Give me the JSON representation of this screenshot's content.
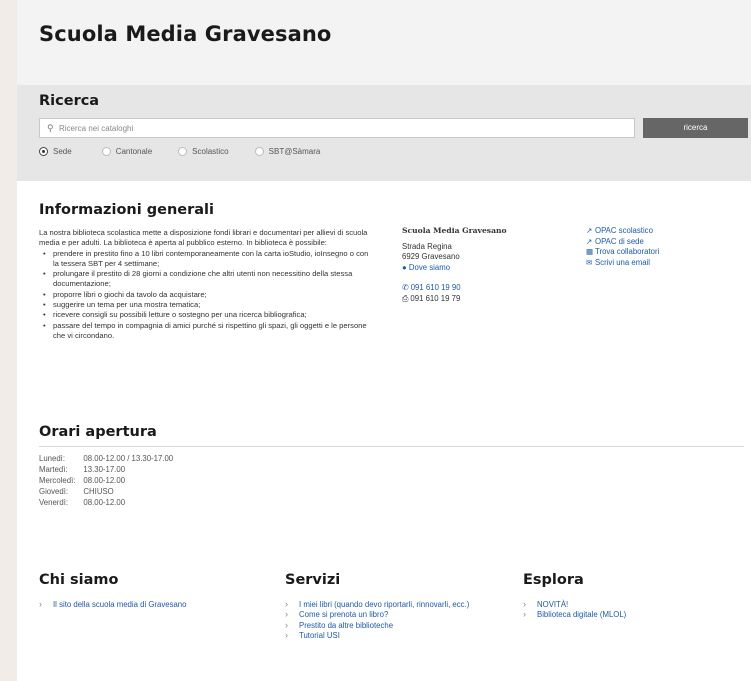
{
  "header": {
    "title": "Scuola Media Gravesano"
  },
  "search": {
    "title": "Ricerca",
    "placeholder": "Ricerca nei cataloghi",
    "button_label": "ricerca",
    "scopes": [
      {
        "label": "Sede",
        "selected": true
      },
      {
        "label": "Cantonale",
        "selected": false
      },
      {
        "label": "Scolastico",
        "selected": false
      },
      {
        "label": "SBT@Sàmara",
        "selected": false
      }
    ]
  },
  "info": {
    "title": "Informazioni generali",
    "description": "La nostra biblioteca scolastica mette a disposizione fondi librari e documentari per allievi di scuola media e per adulti. La biblioteca è aperta al pubblico esterno. In biblioteca è possibile:",
    "bullets": [
      "prendere in prestito fino a 10 libri contemporaneamente con la carta ioStudio, ioInsegno o con la tessera SBT per 4 settimane;",
      "prolungare il prestito di 28 giorni a condizione che altri utenti non necessitino della stessa documentazione;",
      "proporre libri o giochi da tavolo da acquistare;",
      "suggerire un tema per una mostra tematica;",
      "ricevere consigli su possibili letture o sostegno per una ricerca bibliografica;",
      "passare del tempo in compagnia di amici purché si rispettino gli spazi, gli oggetti e le persone che vi circondano."
    ],
    "contact": {
      "name": "Scuola Media Gravesano",
      "street": "Strada Regina",
      "city": "6929 Gravesano",
      "map_link": "Dove siamo",
      "phone": "091 610 19 90",
      "fax": "091 610 19 79"
    },
    "links": [
      {
        "icon": "external-link-icon",
        "label": "OPAC scolastico"
      },
      {
        "icon": "external-link-icon",
        "label": "OPAC di sede"
      },
      {
        "icon": "id-card-icon",
        "label": "Trova collaboratori"
      },
      {
        "icon": "envelope-icon",
        "label": "Scrivi una email"
      }
    ]
  },
  "hours": {
    "title": "Orari apertura",
    "rows": [
      {
        "day": "Lunedì:",
        "time": "08.00-12.00 / 13.30-17.00"
      },
      {
        "day": "Martedì:",
        "time": "13.30-17.00"
      },
      {
        "day": "Mercoledì:",
        "time": "08.00-12.00"
      },
      {
        "day": "Giovedì:",
        "time": "CHIUSO"
      },
      {
        "day": "Venerdì:",
        "time": "08.00-12.00"
      }
    ]
  },
  "footer": {
    "about": {
      "title": "Chi siamo",
      "items": [
        "Il sito della scuola media di Gravesano"
      ]
    },
    "services": {
      "title": "Servizi",
      "items": [
        "I miei libri (quando devo riportarli, rinnovarli, ecc.)",
        "Come si prenota un libro?",
        "Prestito da altre biblioteche",
        "Tutorial USI"
      ]
    },
    "explore": {
      "title": "Esplora",
      "items": [
        "NOVITÀ!",
        "Biblioteca digitale (MLOL)"
      ]
    }
  },
  "colors": {
    "link": "#1f5aa6",
    "button": "#666666",
    "search_band": "#e6e6e6"
  }
}
